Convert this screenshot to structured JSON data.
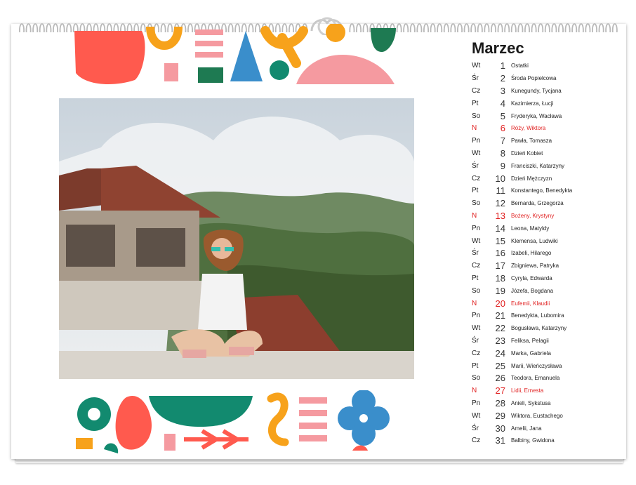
{
  "calendar": {
    "month": "Marzec",
    "days": [
      {
        "dow": "Wt",
        "num": "1",
        "names": "Ostatki"
      },
      {
        "dow": "Śr",
        "num": "2",
        "names": "Środa Popielcowa"
      },
      {
        "dow": "Cz",
        "num": "3",
        "names": "Kunegundy, Tycjana"
      },
      {
        "dow": "Pt",
        "num": "4",
        "names": "Kazimierza, Łucji"
      },
      {
        "dow": "So",
        "num": "5",
        "names": "Fryderyka, Wacława"
      },
      {
        "dow": "N",
        "num": "6",
        "names": "Róży, Wiktora"
      },
      {
        "dow": "Pn",
        "num": "7",
        "names": "Pawła, Tomasza"
      },
      {
        "dow": "Wt",
        "num": "8",
        "names": "Dzień Kobiet"
      },
      {
        "dow": "Śr",
        "num": "9",
        "names": "Franciszki, Katarzyny"
      },
      {
        "dow": "Cz",
        "num": "10",
        "names": "Dzień Mężczyzn"
      },
      {
        "dow": "Pt",
        "num": "11",
        "names": "Konstantego, Benedykta"
      },
      {
        "dow": "So",
        "num": "12",
        "names": "Bernarda, Grzegorza"
      },
      {
        "dow": "N",
        "num": "13",
        "names": "Bożeny, Krystyny"
      },
      {
        "dow": "Pn",
        "num": "14",
        "names": "Leona, Matyldy"
      },
      {
        "dow": "Wt",
        "num": "15",
        "names": "Klemensa, Ludwiki"
      },
      {
        "dow": "Śr",
        "num": "16",
        "names": "Izabeli, Hilarego"
      },
      {
        "dow": "Cz",
        "num": "17",
        "names": "Zbigniewa, Patryka"
      },
      {
        "dow": "Pt",
        "num": "18",
        "names": "Cyryla, Edwarda"
      },
      {
        "dow": "So",
        "num": "19",
        "names": "Józefa, Bogdana"
      },
      {
        "dow": "N",
        "num": "20",
        "names": "Eufemii, Klaudii"
      },
      {
        "dow": "Pn",
        "num": "21",
        "names": "Benedykta, Lubomira"
      },
      {
        "dow": "Wt",
        "num": "22",
        "names": "Bogusława, Katarzyny"
      },
      {
        "dow": "Śr",
        "num": "23",
        "names": "Feliksa, Pelagii"
      },
      {
        "dow": "Cz",
        "num": "24",
        "names": "Marka, Gabriela"
      },
      {
        "dow": "Pt",
        "num": "25",
        "names": "Marii, Wieńczysława"
      },
      {
        "dow": "So",
        "num": "26",
        "names": "Teodora, Emanuela"
      },
      {
        "dow": "N",
        "num": "27",
        "names": "Lidii, Ernesta"
      },
      {
        "dow": "Pn",
        "num": "28",
        "names": "Anieli, Sykstusa"
      },
      {
        "dow": "Wt",
        "num": "29",
        "names": "Wiktora, Eustachego"
      },
      {
        "dow": "Śr",
        "num": "30",
        "names": "Amelii, Jana"
      },
      {
        "dow": "Cz",
        "num": "31",
        "names": "Balbiny, Gwidona"
      }
    ],
    "colors": {
      "sunday": "#e01e1e",
      "coral": "#ff5a4e",
      "orange": "#f7a21b",
      "pink": "#f59aa0",
      "teal": "#128a6f",
      "blue": "#3a8ecb",
      "green": "#1e7a52"
    }
  }
}
